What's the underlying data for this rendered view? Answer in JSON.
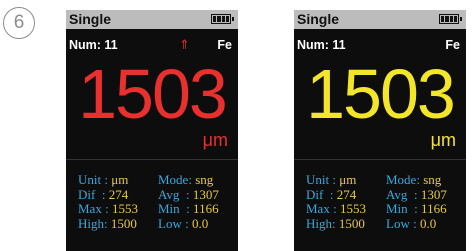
{
  "step_number": "6",
  "screens": [
    {
      "id": "left",
      "title": "Single",
      "num": "Num: 11",
      "alert_arrow": "⇑",
      "material": "Fe",
      "reading": "1503",
      "unit": "μm",
      "reading_color": "#e8302f",
      "stats": {
        "unit_label": "Unit",
        "unit_value": "μm",
        "mode_label": "Mode",
        "mode_value": "sng",
        "dif_label": "Dif",
        "dif_value": "274",
        "avg_label": "Avg",
        "avg_value": "1307",
        "max_label": "Max",
        "max_value": "1553",
        "min_label": "Min",
        "min_value": "1166",
        "high_label": "High",
        "high_value": "1500",
        "low_label": "Low",
        "low_value": "0.0"
      }
    },
    {
      "id": "right",
      "title": "Single",
      "num": "Num: 11",
      "alert_arrow": "",
      "material": "Fe",
      "reading": "1503",
      "unit": "μm",
      "reading_color": "#f2e52a",
      "stats": {
        "unit_label": "Unit",
        "unit_value": "μm",
        "mode_label": "Mode",
        "mode_value": "sng",
        "dif_label": "Dif",
        "dif_value": "274",
        "avg_label": "Avg",
        "avg_value": "1307",
        "max_label": "Max",
        "max_value": "1553",
        "min_label": "Min",
        "min_value": "1166",
        "high_label": "High",
        "high_value": "1500",
        "low_label": "Low",
        "low_value": "0.0"
      }
    }
  ],
  "colors": {
    "screen_bg": "#0d0d0d",
    "titlebar_bg": "#bcbcbc",
    "stat_label": "#3aa8e0",
    "stat_value": "#e6c84a",
    "alert_arrow": "#e02a2a"
  }
}
